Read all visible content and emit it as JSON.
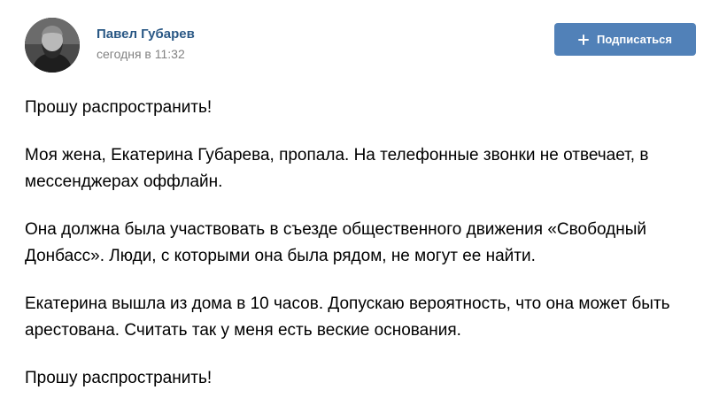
{
  "post": {
    "author": "Павел Губарев",
    "time": "сегодня в 11:32",
    "subscribe_label": "Подписаться",
    "subscribe_icon": "plus-icon",
    "accent_color": "#5181b8",
    "author_color": "#2a5885",
    "paragraphs": [
      "Прошу распространить!",
      "Моя жена, Екатерина Губарева, пропала. На телефонные звонки не отвечает, в мессенджерах оффлайн.",
      "Она должна была участвовать в съезде общественного движения «Свободный Донбасс». Люди, с которыми она была рядом, не могут ее найти.",
      "Екатерина вышла из дома в 10 часов. Допускаю вероятность, что она может быть арестована. Считать так у меня есть веские основания.",
      "Прошу распространить!"
    ]
  }
}
